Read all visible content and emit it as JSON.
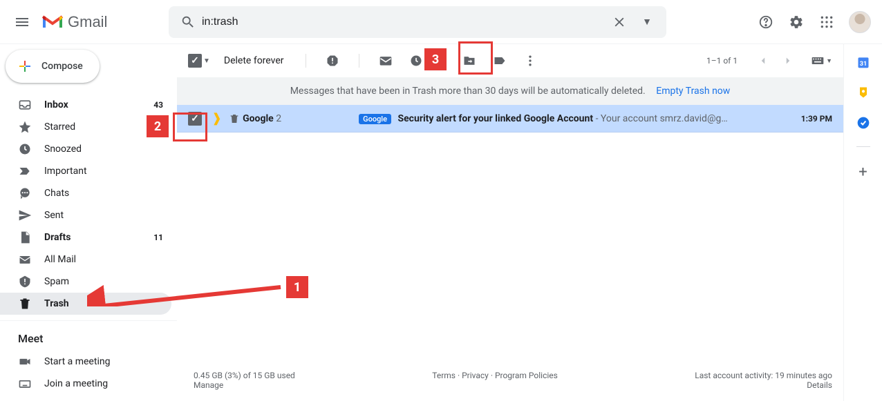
{
  "header": {
    "logo_text": "Gmail",
    "search_value": "in:trash"
  },
  "compose_label": "Compose",
  "sidebar": {
    "items": [
      {
        "label": "Inbox",
        "count": "43",
        "bold": true,
        "icon": "inbox"
      },
      {
        "label": "Starred",
        "icon": "star"
      },
      {
        "label": "Snoozed",
        "icon": "clock"
      },
      {
        "label": "Important",
        "icon": "important"
      },
      {
        "label": "Chats",
        "icon": "chat"
      },
      {
        "label": "Sent",
        "icon": "sent"
      },
      {
        "label": "Drafts",
        "count": "11",
        "bold": true,
        "icon": "draft"
      },
      {
        "label": "All Mail",
        "icon": "allmail"
      },
      {
        "label": "Spam",
        "icon": "spam"
      },
      {
        "label": "Trash",
        "icon": "trash",
        "active": true
      }
    ],
    "meet_header": "Meet",
    "meet_items": [
      {
        "label": "Start a meeting",
        "icon": "video"
      },
      {
        "label": "Join a meeting",
        "icon": "keyboard"
      }
    ]
  },
  "toolbar": {
    "delete_forever": "Delete forever",
    "page_info": "1–1 of 1"
  },
  "banner": {
    "text": "Messages that have been in Trash more than 30 days will be automatically deleted.",
    "link": "Empty Trash now"
  },
  "messages": [
    {
      "sender": "Google",
      "sender_count": "2",
      "chip": "Google",
      "subject": "Security alert for your linked Google Account",
      "snippet": " - Your account smrz.david@g…",
      "time": "1:39 PM"
    }
  ],
  "footer": {
    "storage": "0.45 GB (3%) of 15 GB used",
    "manage": "Manage",
    "terms": "Terms",
    "privacy": "Privacy",
    "policies": "Program Policies",
    "activity": "Last account activity: 19 minutes ago",
    "details": "Details"
  },
  "annotations": {
    "n1": "1",
    "n2": "2",
    "n3": "3"
  }
}
